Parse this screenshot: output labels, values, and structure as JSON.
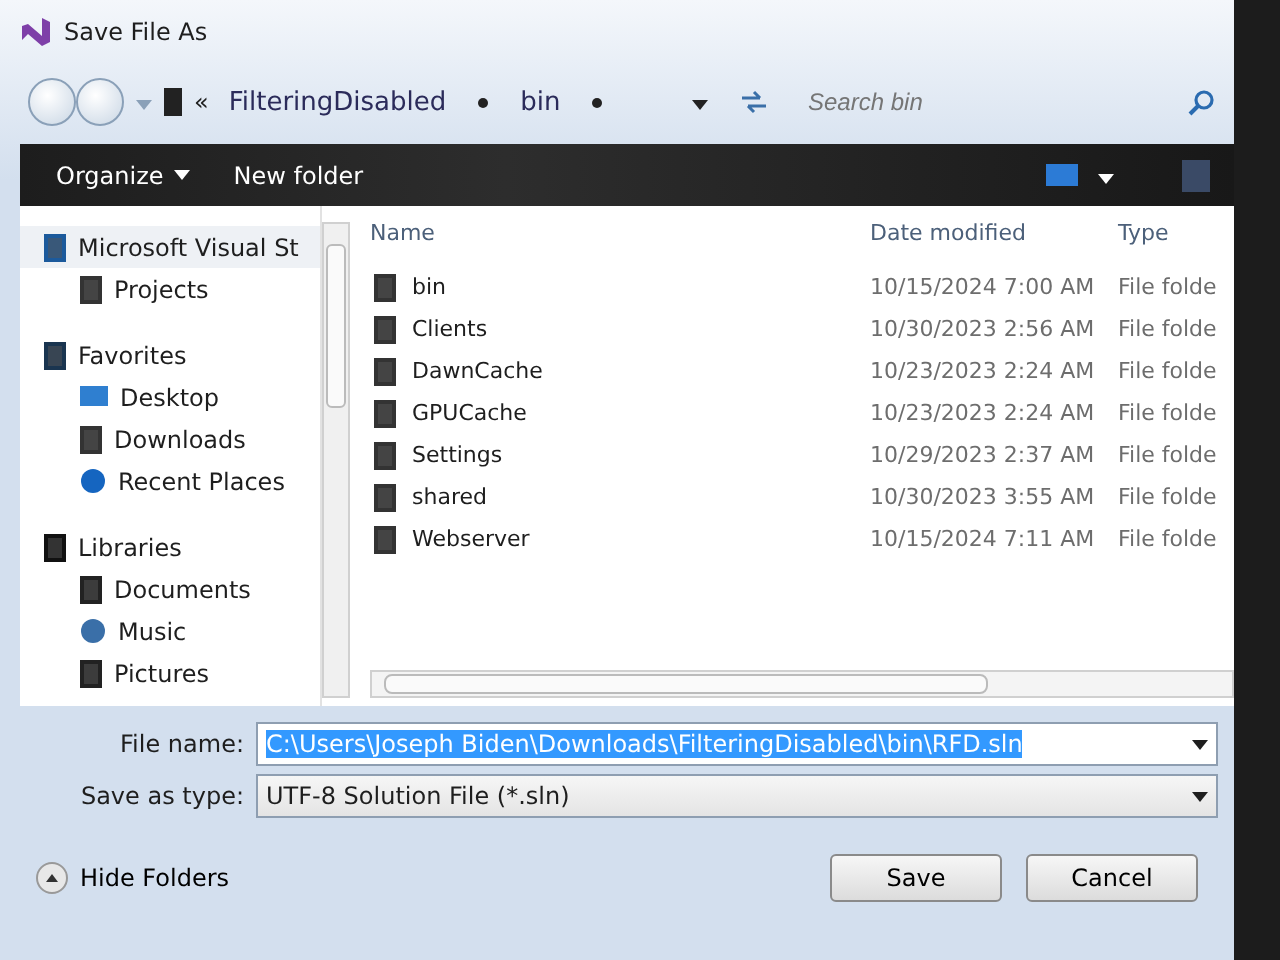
{
  "window": {
    "title": "Save File As"
  },
  "address": {
    "overflow": "«",
    "crumbs": [
      "FilteringDisabled",
      "bin"
    ],
    "search_placeholder": "Search bin"
  },
  "toolbar": {
    "buttons": [
      "Organize",
      "New folder"
    ]
  },
  "sidebar": {
    "items": [
      {
        "label": "Microsoft Visual St",
        "kind": "vs",
        "selected": true,
        "children": [
          {
            "label": "Projects",
            "kind": "folder",
            "selected": false
          }
        ]
      },
      {
        "label": "Favorites",
        "kind": "star",
        "selected": false,
        "children": [
          {
            "label": "Desktop",
            "kind": "desktop",
            "selected": false
          },
          {
            "label": "Downloads",
            "kind": "folder",
            "selected": false
          },
          {
            "label": "Recent Places",
            "kind": "recent",
            "selected": false
          }
        ]
      },
      {
        "label": "Libraries",
        "kind": "library",
        "selected": false,
        "children": [
          {
            "label": "Documents",
            "kind": "doc",
            "selected": false
          },
          {
            "label": "Music",
            "kind": "music",
            "selected": false
          },
          {
            "label": "Pictures",
            "kind": "doc",
            "selected": false
          }
        ]
      }
    ]
  },
  "table": {
    "columns": [
      "Name",
      "Date modified",
      "Type"
    ],
    "rows": [
      {
        "name": "bin",
        "date": "10/15/2024 7:00 AM",
        "type": "File folde"
      },
      {
        "name": "Clients",
        "date": "10/30/2023 2:56 AM",
        "type": "File folde"
      },
      {
        "name": "DawnCache",
        "date": "10/23/2023 2:24 AM",
        "type": "File folde"
      },
      {
        "name": "GPUCache",
        "date": "10/23/2023 2:24 AM",
        "type": "File folde"
      },
      {
        "name": "Settings",
        "date": "10/29/2023 2:37 AM",
        "type": "File folde"
      },
      {
        "name": "shared",
        "date": "10/30/2023 3:55 AM",
        "type": "File folde"
      },
      {
        "name": "Webserver",
        "date": "10/15/2024 7:11 AM",
        "type": "File folde"
      }
    ]
  },
  "form": {
    "file_name_label": "File name:",
    "file_name": "C:\\Users\\Joseph Biden\\Downloads\\FilteringDisabled\\bin\\RFD.sln",
    "file_name_selected": true,
    "type_label": "Save as type:",
    "type_value": "UTF-8 Solution File (*.sln)"
  },
  "footer": {
    "hide_folders": "Hide Folders",
    "buttons": [
      "Save",
      "Cancel"
    ]
  }
}
